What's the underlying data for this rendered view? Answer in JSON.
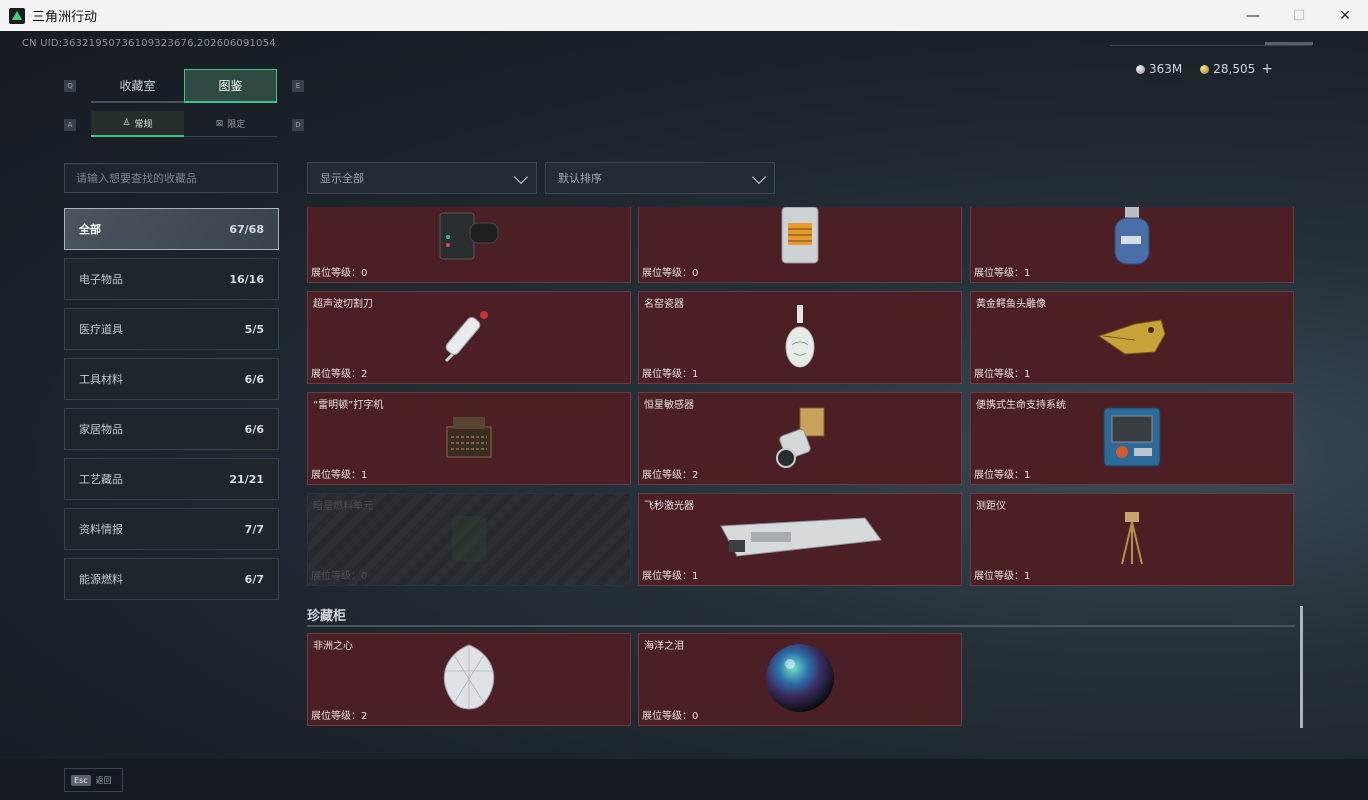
{
  "window": {
    "title": "三角洲行动",
    "minimize": "—",
    "maximize": "☐",
    "close": "✕"
  },
  "header": {
    "uid": "CN UID:36321950736109323676,202606091054"
  },
  "currency": {
    "silver": "363M",
    "gold": "28,505",
    "add": "+"
  },
  "keyhints": {
    "q": "Q",
    "e": "E",
    "a": "A",
    "d": "D"
  },
  "tabs": [
    {
      "label": "收藏室"
    },
    {
      "label": "图鉴"
    }
  ],
  "subtabs": [
    {
      "label": "常规",
      "icon": "♙"
    },
    {
      "label": "限定",
      "icon": "⊠"
    }
  ],
  "search": {
    "placeholder": "请输入想要查找的收藏品"
  },
  "categories": [
    {
      "label": "全部",
      "count": "67/68"
    },
    {
      "label": "电子物品",
      "count": "16/16"
    },
    {
      "label": "医疗道具",
      "count": "5/5"
    },
    {
      "label": "工具材料",
      "count": "6/6"
    },
    {
      "label": "家居物品",
      "count": "6/6"
    },
    {
      "label": "工艺藏品",
      "count": "21/21"
    },
    {
      "label": "资料情报",
      "count": "7/7"
    },
    {
      "label": "能源燃料",
      "count": "6/7"
    }
  ],
  "filters": {
    "show": "显示全部",
    "sort": "默认排序"
  },
  "items": [
    {
      "name": "",
      "level": "展位等级：0",
      "icon": "electronic-device-icon"
    },
    {
      "name": "",
      "level": "展位等级：0",
      "icon": "heater-icon"
    },
    {
      "name": "",
      "level": "展位等级：1",
      "icon": "gas-canister-icon"
    },
    {
      "name": "超声波切割刀",
      "level": "展位等级：2",
      "icon": "ultrasonic-knife-icon"
    },
    {
      "name": "名窑瓷器",
      "level": "展位等级：1",
      "icon": "porcelain-vase-icon"
    },
    {
      "name": "黄金鳄鱼头雕像",
      "level": "展位等级：1",
      "icon": "gold-crocodile-icon"
    },
    {
      "name": "“雷明顿”打字机",
      "level": "展位等级：1",
      "icon": "typewriter-icon"
    },
    {
      "name": "恒星敏感器",
      "level": "展位等级：2",
      "icon": "star-sensor-icon"
    },
    {
      "name": "便携式生命支持系统",
      "level": "展位等级：1",
      "icon": "life-support-icon"
    },
    {
      "name": "暗星燃料单元",
      "level": "展位等级：0",
      "icon": "fuel-cell-icon",
      "locked": true
    },
    {
      "name": "飞秒激光器",
      "level": "展位等级：1",
      "icon": "laser-icon"
    },
    {
      "name": "测距仪",
      "level": "展位等级：1",
      "icon": "rangefinder-icon"
    }
  ],
  "treasure": {
    "title": "珍藏柜",
    "items": [
      {
        "name": "非洲之心",
        "level": "展位等级：2",
        "icon": "diamond-icon"
      },
      {
        "name": "海洋之泪",
        "level": "展位等级：0",
        "icon": "ocean-orb-icon"
      }
    ]
  },
  "footer": {
    "esc_key": "Esc",
    "esc_label": "返回"
  }
}
